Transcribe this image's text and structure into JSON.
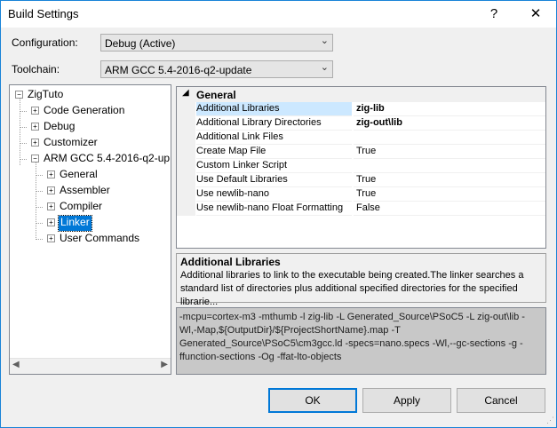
{
  "window": {
    "title": "Build Settings",
    "help_glyph": "?",
    "close_glyph": "✕"
  },
  "configuration": {
    "label": "Configuration:",
    "value": "Debug (Active)"
  },
  "toolchain": {
    "label": "Toolchain:",
    "value": "ARM GCC 5.4-2016-q2-update"
  },
  "tree": {
    "root": "ZigTuto",
    "items": [
      "Code Generation",
      "Debug",
      "Customizer",
      "ARM GCC 5.4-2016-q2-up",
      "General",
      "Assembler",
      "Compiler",
      "Linker",
      "User Commands"
    ],
    "selected": "Linker"
  },
  "properties": {
    "category": "General",
    "rows": [
      {
        "label": "Additional Libraries",
        "value": "zig-lib",
        "bold": true
      },
      {
        "label": "Additional Library Directories",
        "value": "zig-out\\lib",
        "bold": true
      },
      {
        "label": "Additional Link Files",
        "value": ""
      },
      {
        "label": "Create Map File",
        "value": "True"
      },
      {
        "label": "Custom Linker Script",
        "value": ""
      },
      {
        "label": "Use Default Libraries",
        "value": "True"
      },
      {
        "label": "Use newlib-nano",
        "value": "True"
      },
      {
        "label": "Use newlib-nano Float Formatting",
        "value": "False"
      }
    ]
  },
  "description": {
    "title": "Additional Libraries",
    "text": "Additional libraries to link to the executable being created.The linker searches a standard list of directories plus additional specified directories for the specified librarie..."
  },
  "command_line": "-mcpu=cortex-m3 -mthumb -l zig-lib -L Generated_Source\\PSoC5 -L zig-out\\lib -Wl,-Map,${OutputDir}/${ProjectShortName}.map -T Generated_Source\\PSoC5\\cm3gcc.ld -specs=nano.specs -Wl,--gc-sections -g -ffunction-sections -Og -ffat-lto-objects",
  "buttons": {
    "ok": "OK",
    "apply": "Apply",
    "cancel": "Cancel"
  },
  "colors": {
    "accent": "#0078d7",
    "selection": "#0078d7",
    "row_highlight": "#cce8ff"
  }
}
